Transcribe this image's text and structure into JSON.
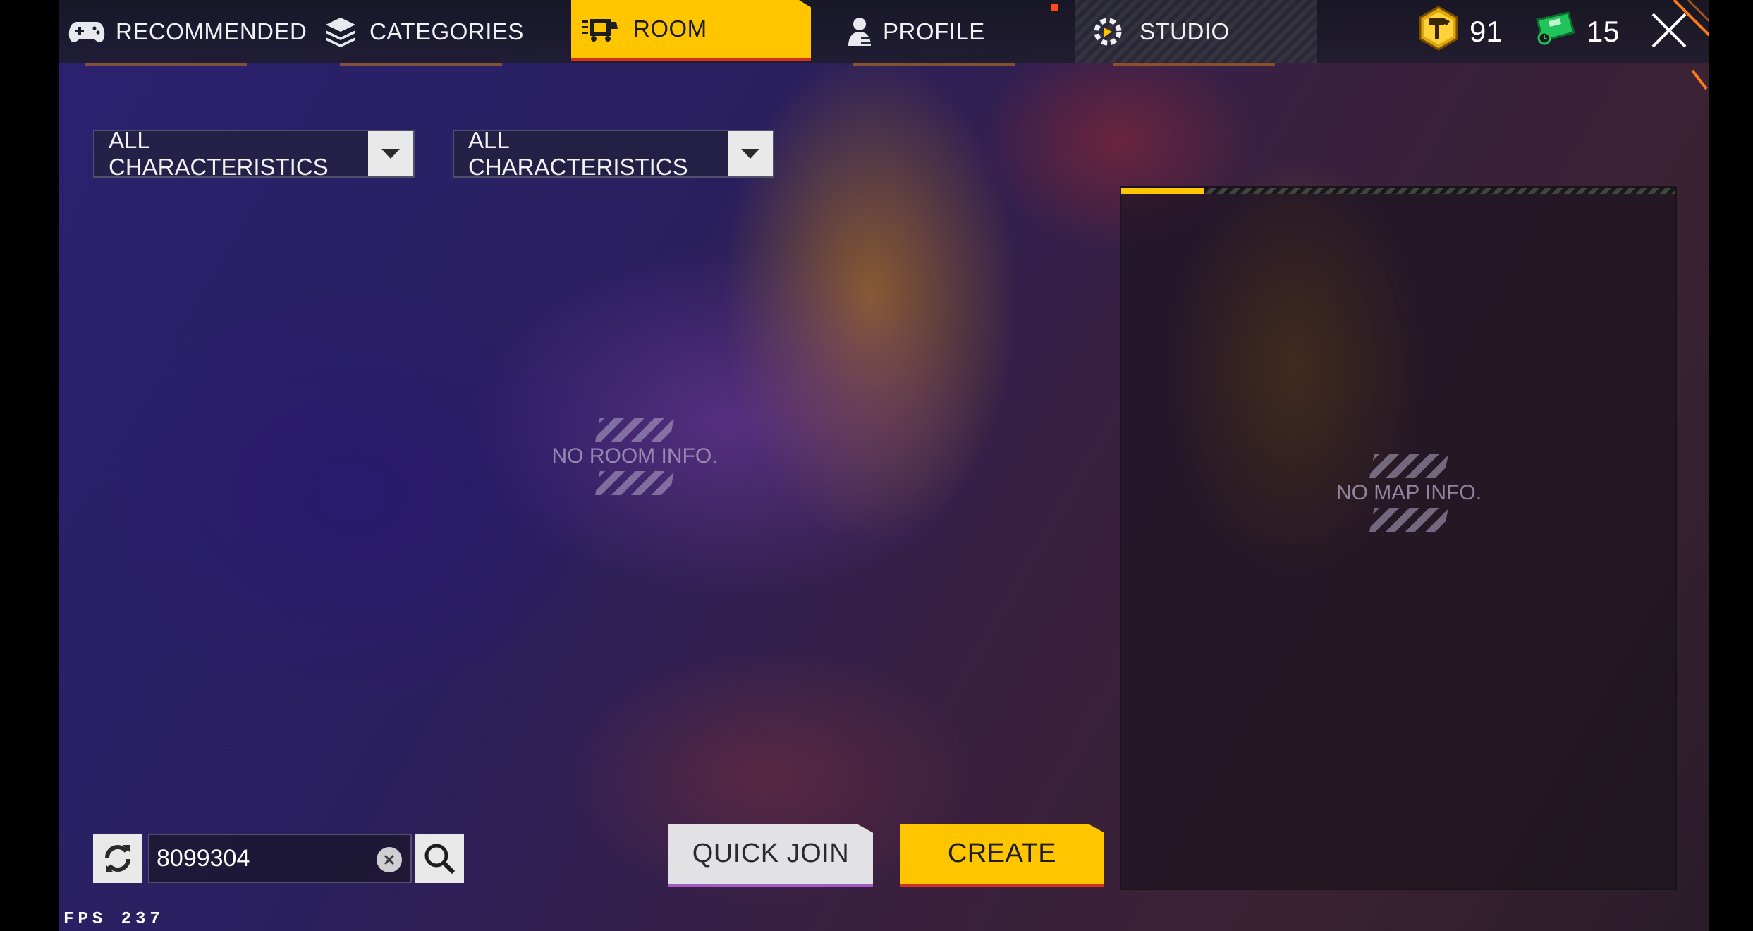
{
  "nav": {
    "tabs": [
      {
        "label": "RECOMMENDED",
        "icon": "gamepad-icon"
      },
      {
        "label": "CATEGORIES",
        "icon": "layers-icon"
      },
      {
        "label": "ROOM",
        "icon": "room-icon",
        "active": true
      },
      {
        "label": "PROFILE",
        "icon": "profile-icon"
      },
      {
        "label": "STUDIO",
        "icon": "studio-icon"
      }
    ],
    "accent": "#ffc600"
  },
  "currencies": {
    "gold": {
      "value": "91",
      "icon": "hammer-coin-icon"
    },
    "ticket": {
      "value": "15",
      "icon": "ticket-icon"
    }
  },
  "filters": {
    "first": "ALL CHARACTERISTICS",
    "second": "ALL CHARACTERISTICS"
  },
  "room_list": {
    "empty_text": "NO ROOM INFO."
  },
  "map_panel": {
    "empty_text": "NO MAP INFO.",
    "loading_progress": 0.15
  },
  "search": {
    "value": "8099304"
  },
  "actions": {
    "quick_join": "QUICK JOIN",
    "create": "CREATE"
  },
  "fps": "FPS 237"
}
